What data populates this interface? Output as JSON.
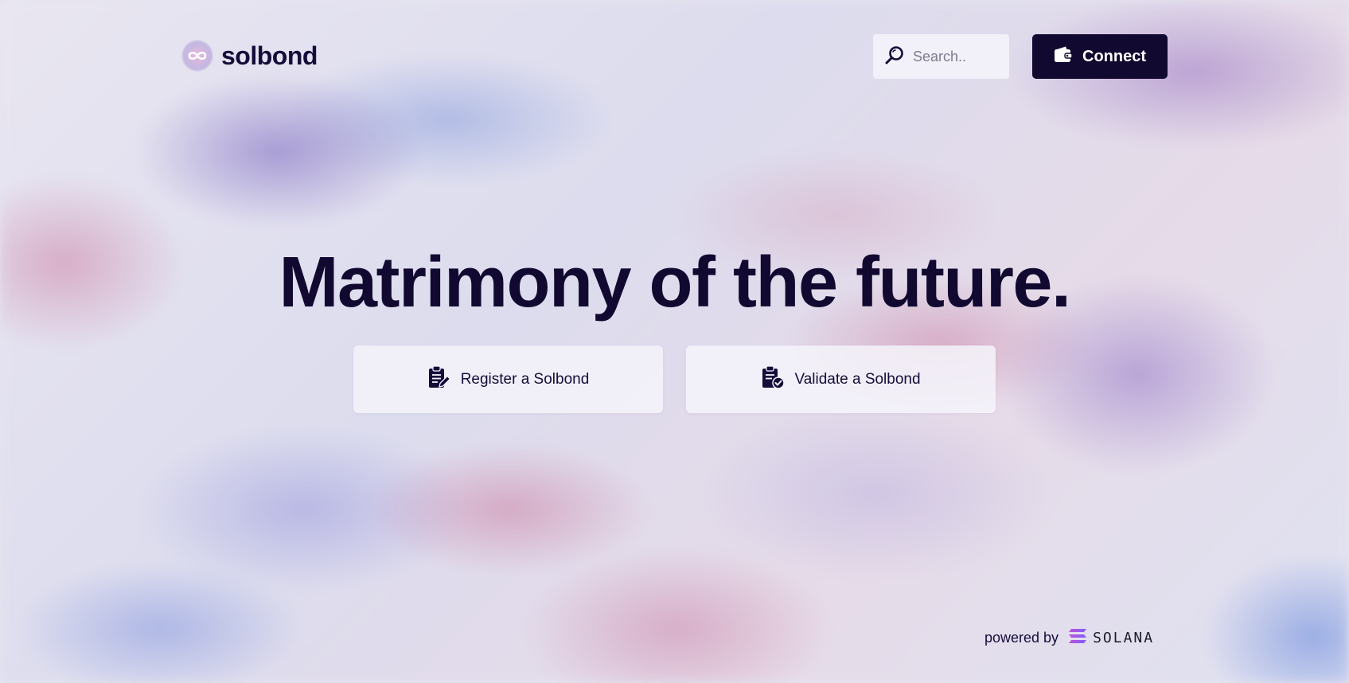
{
  "header": {
    "logo_text": "solbond",
    "logo_icon": "infinity-icon",
    "search_placeholder": "Search..",
    "search_icon": "search-icon",
    "connect_label": "Connect",
    "connect_icon": "wallet-icon"
  },
  "hero": {
    "headline": "Matrimony of the future."
  },
  "actions": [
    {
      "label": "Register a Solbond",
      "icon": "clipboard-edit-icon"
    },
    {
      "label": "Validate a Solbond",
      "icon": "clipboard-check-icon"
    }
  ],
  "footer": {
    "powered_by": "powered by",
    "brand": "SOLANA",
    "brand_icon": "solana-logo-icon"
  },
  "colors": {
    "primary": "#120931",
    "button_text": "#ffffff",
    "card_bg": "#f5f3fa"
  }
}
